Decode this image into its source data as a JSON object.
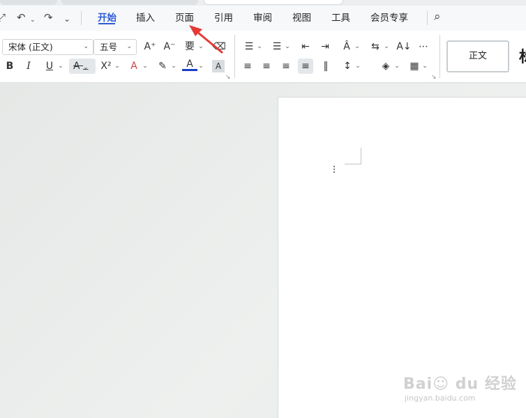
{
  "quick_access": {
    "redo_partial": "⤢",
    "undo": "↶",
    "redo": "↷",
    "more": "⌄"
  },
  "menu": {
    "tabs": [
      {
        "label": "开始",
        "active": true
      },
      {
        "label": "插入"
      },
      {
        "label": "页面"
      },
      {
        "label": "引用"
      },
      {
        "label": "审阅"
      },
      {
        "label": "视图"
      },
      {
        "label": "工具"
      },
      {
        "label": "会员专享"
      }
    ],
    "search_icon": "⌕"
  },
  "ribbon": {
    "font_name": "宋体 (正文)",
    "font_size": "五号",
    "caret": "⌄",
    "grow_font": "A⁺",
    "shrink_font": "A⁻",
    "phonetic": "要",
    "clear_format": "⌫",
    "bold": "B",
    "italic": "I",
    "underline": "U",
    "strikethrough": "A",
    "superscript": "X²",
    "text_effect": "A",
    "highlight": "✎",
    "font_color": "A",
    "char_shading": "A",
    "bullets": "☰",
    "numbering": "☰",
    "decrease_indent": "⇤",
    "increase_indent": "⇥",
    "char_spacing": "Â",
    "text_direction": "⇆",
    "sort": "A↓",
    "show_marks": "⋯",
    "align_left": "≡",
    "align_center": "≡",
    "align_right": "≡",
    "align_justify": "≡",
    "distributed": "‖",
    "line_spacing": "↕",
    "shading": "◈",
    "borders": "▦",
    "dialog_launcher": "↘",
    "style_normal": "正文",
    "style_next": "标"
  },
  "document": {
    "drag_handle": "⠇"
  },
  "watermark": {
    "logo": "Bai☺ du 经验",
    "url": "jingyan.baidu.com"
  },
  "colors": {
    "accent": "#2d5bd6",
    "arrow": "#e53935",
    "font_color_bar": "#1a3fc7"
  }
}
